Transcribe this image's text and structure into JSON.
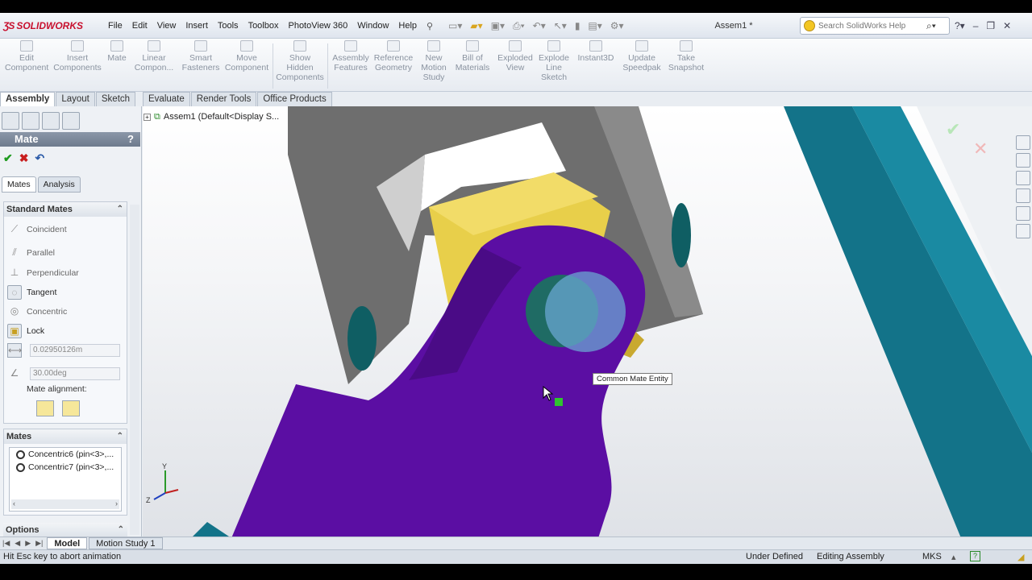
{
  "app": {
    "name": "SOLIDWORKS",
    "document_title": "Assem1 *"
  },
  "menu": [
    "File",
    "Edit",
    "View",
    "Insert",
    "Tools",
    "Toolbox",
    "PhotoView 360",
    "Window",
    "Help"
  ],
  "search": {
    "placeholder": "Search SolidWorks Help"
  },
  "commands": [
    {
      "label": "Edit Component"
    },
    {
      "label": "Insert Components"
    },
    {
      "label": "Mate"
    },
    {
      "label": "Linear Compon..."
    },
    {
      "label": "Smart Fasteners"
    },
    {
      "label": "Move Component"
    },
    {
      "label": "Show Hidden Components"
    },
    {
      "label": "Assembly Features"
    },
    {
      "label": "Reference Geometry"
    },
    {
      "label": "New Motion Study"
    },
    {
      "label": "Bill of Materials"
    },
    {
      "label": "Exploded View"
    },
    {
      "label": "Explode Line Sketch"
    },
    {
      "label": "Instant3D"
    },
    {
      "label": "Update Speedpak"
    },
    {
      "label": "Take Snapshot"
    }
  ],
  "cm_tabs": [
    "Assembly",
    "Layout",
    "Sketch",
    "Evaluate",
    "Render Tools",
    "Office Products"
  ],
  "tree": {
    "root": "Assem1  (Default<Display S..."
  },
  "mate_panel": {
    "title": "Mate",
    "help": "?",
    "subtabs": [
      "Mates",
      "Analysis"
    ],
    "standard_header": "Standard Mates",
    "items": [
      {
        "label": "Coincident",
        "selected": false,
        "icon": "coincident-icon"
      },
      {
        "label": "Parallel",
        "selected": false,
        "icon": "parallel-icon"
      },
      {
        "label": "Perpendicular",
        "selected": false,
        "icon": "perpendicular-icon"
      },
      {
        "label": "Tangent",
        "selected": true,
        "icon": "tangent-icon"
      },
      {
        "label": "Concentric",
        "selected": false,
        "icon": "concentric-icon"
      },
      {
        "label": "Lock",
        "selected": true,
        "icon": "lock-icon"
      }
    ],
    "distance": "0.02950126m",
    "angle": "30.00deg",
    "alignment_label": "Mate alignment:",
    "mates_header": "Mates",
    "mates": [
      "Concentric6 (pin<3>,...",
      "Concentric7 (pin<3>,..."
    ],
    "options_header": "Options"
  },
  "tooltip": "Common Mate Entity",
  "bottom_tabs": [
    "Model",
    "Motion Study 1"
  ],
  "status": {
    "message": "Hit Esc key to abort animation",
    "state": "Under Defined",
    "mode": "Editing Assembly",
    "units": "MKS"
  },
  "colors": {
    "purple_part": "#5b0ea3",
    "teal_part": "#137389",
    "gray_part": "#6e6e6e",
    "yellow_block": "#e8cf4a"
  }
}
